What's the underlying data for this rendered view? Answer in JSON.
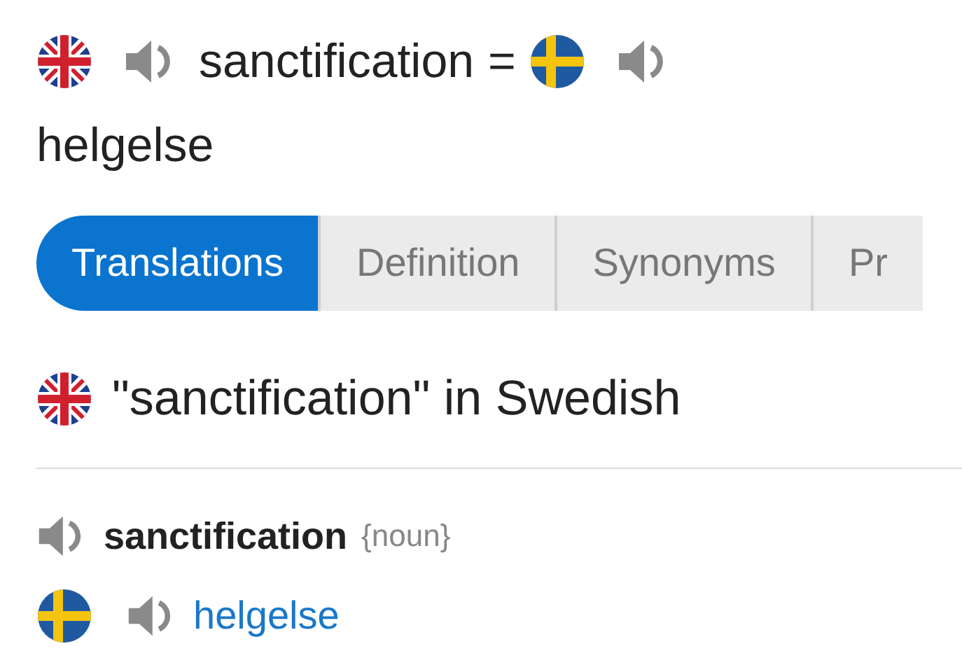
{
  "header": {
    "source_term": "sanctification",
    "equals": "=",
    "target_term": "helgelse"
  },
  "tabs": [
    {
      "label": "Translations",
      "selected": true
    },
    {
      "label": "Definition",
      "selected": false
    },
    {
      "label": "Synonyms",
      "selected": false
    },
    {
      "label": "Pr",
      "selected": false
    }
  ],
  "section": {
    "heading": "\"sanctification\" in Swedish",
    "entries": [
      {
        "term": "sanctification",
        "part_of_speech": "{noun}",
        "translations": [
          {
            "text": "helgelse"
          }
        ]
      }
    ]
  }
}
